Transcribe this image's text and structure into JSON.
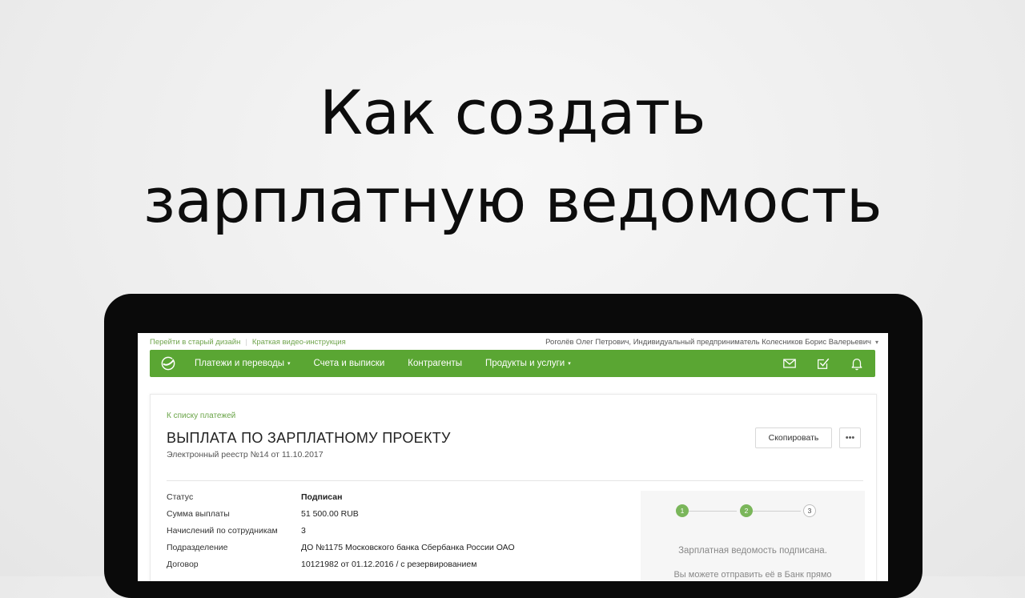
{
  "headline": {
    "line1": "Как создать",
    "line2": "зарплатную ведомость"
  },
  "topbar": {
    "old_design_link": "Перейти в старый дизайн",
    "video_link": "Краткая видео-инструкция",
    "user": "Роголёв Олег Петрович, Индивидуальный предприниматель Колесников Борис Валерьевич",
    "user_caret": "▾"
  },
  "nav": {
    "brand_color": "#5aa633",
    "items": [
      {
        "label": "Платежи и переводы",
        "caret": "▾"
      },
      {
        "label": "Счета и выписки"
      },
      {
        "label": "Контрагенты"
      },
      {
        "label": "Продукты и услуги",
        "caret": "▾"
      }
    ],
    "icons": [
      "mail-icon",
      "tasks-check-icon",
      "bell-icon"
    ]
  },
  "page": {
    "back_link": "К списку платежей",
    "title": "ВЫПЛАТА ПО ЗАРПЛАТНОМУ ПРОЕКТУ",
    "subtitle": "Электронный реестр №14 от 11.10.2017",
    "copy_button": "Скопировать",
    "more_button": "•••"
  },
  "details": [
    {
      "label": "Статус",
      "value": "Подписан"
    },
    {
      "label": "Сумма выплаты",
      "value": "51 500.00 RUB"
    },
    {
      "label": "Начислений по сотрудникам",
      "value": "3"
    },
    {
      "label": "Подразделение",
      "value": "ДО №1175 Московского банка Сбербанка России ОАО"
    },
    {
      "label": "Договор",
      "value": "10121982 от 01.12.2016 / с резервированием"
    }
  ],
  "steps": {
    "items": [
      {
        "number": "1",
        "state": "done"
      },
      {
        "number": "2",
        "state": "done"
      },
      {
        "number": "3",
        "state": "current"
      }
    ],
    "message": "Зарплатная ведомость подписана.",
    "message_more": "Вы можете отправить её в Банк прямо"
  }
}
